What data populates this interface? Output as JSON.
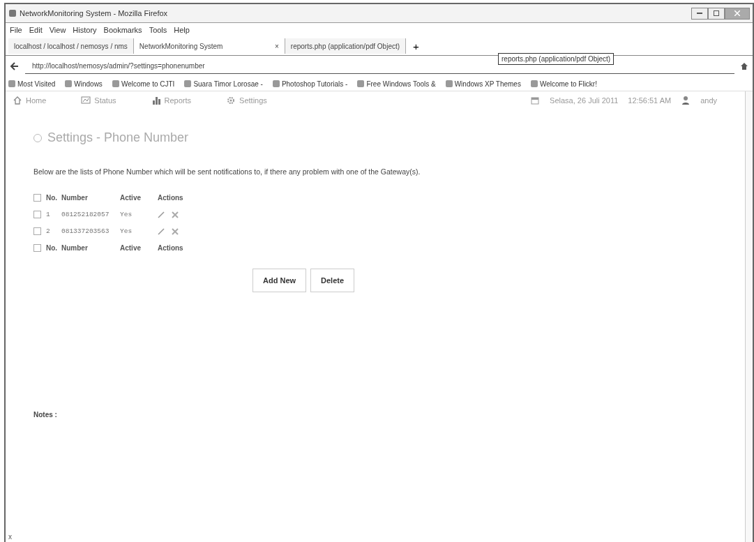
{
  "window": {
    "title": "NetworkMonitoring System - Mozilla Firefox"
  },
  "menu": [
    "File",
    "Edit",
    "View",
    "History",
    "Bookmarks",
    "Tools",
    "Help"
  ],
  "tabs": [
    {
      "label": "localhost / localhost / nemosys / nms",
      "selected": false
    },
    {
      "label": "NetworkMonitoring System",
      "selected": true,
      "close": "×"
    },
    {
      "label": "reports.php (application/pdf Object)",
      "selected": false
    }
  ],
  "new_tab": "+",
  "tooltip": "reports.php (application/pdf Object)",
  "url": "http://localhost/nemosys/admin/?settings=phonenumber",
  "bookmarks": [
    "Most Visited",
    "Windows",
    "Welcome to CJTI",
    "Suara Timor Lorosae -",
    "Photoshop Tutorials -",
    "Free Windows Tools &",
    "Windows XP Themes",
    "Welcome to Flickr!"
  ],
  "app_nav": [
    {
      "label": "Home"
    },
    {
      "label": "Status"
    },
    {
      "label": "Reports"
    },
    {
      "label": "Settings"
    }
  ],
  "date": "Selasa, 26 Juli 2011",
  "time": "12:56:51 AM",
  "user": "andy",
  "page_title": "Settings - Phone Number",
  "description": "Below are the lists of Phone Number which will be sent notifications to, if there any problem with one of the Gateway(s).",
  "table": {
    "columns": [
      "No.",
      "Number",
      "Active",
      "Actions"
    ],
    "rows": [
      {
        "no": "1",
        "number": "081252182057",
        "active": "Yes",
        "checked": false
      },
      {
        "no": "2",
        "number": "081337203563",
        "active": "Yes",
        "checked": false
      }
    ],
    "footer_columns": [
      "No.",
      "Number",
      "Active",
      "Actions"
    ],
    "header_checked": false,
    "footer_checked": false
  },
  "buttons": [
    "Add New",
    "Delete"
  ],
  "notes_label": "Notes :",
  "status_bar": "x"
}
